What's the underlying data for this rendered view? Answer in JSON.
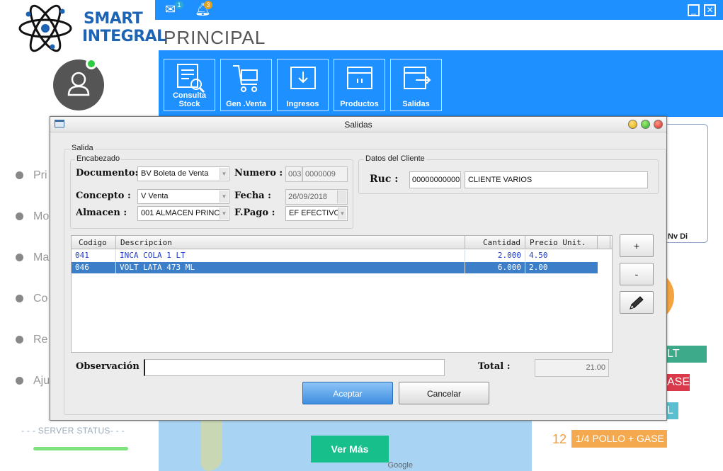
{
  "app": {
    "brand_line1": "SMART",
    "brand_line2": "INTEGRAL",
    "page_title": "PRINCIPAL",
    "mail_badge": "1",
    "bell_badge": "3",
    "ribbon": [
      {
        "label": "Consulta Stock",
        "icon": "stock-search-icon"
      },
      {
        "label": "Gen .Venta",
        "icon": "cart-icon"
      },
      {
        "label": "Ingresos",
        "icon": "inbox-download-icon"
      },
      {
        "label": "Productos",
        "icon": "box-icon"
      },
      {
        "label": "Salidas",
        "icon": "box-out-icon"
      }
    ],
    "menu": [
      "Pri",
      "Mo",
      "Ma",
      "Co",
      "Re",
      "Aju"
    ],
    "server_status": "- - - SERVER STATUS- - -",
    "ver_mas": "Ver Más",
    "map_credit": "Google",
    "right_panel_text": "Nv   Di",
    "chips": [
      "LT",
      "ASE",
      "L"
    ],
    "product_rank": "12",
    "product_name": "1/4 POLLO + GASE"
  },
  "dialog": {
    "title": "Salidas",
    "outer_group": "Salida",
    "header_group": "Encabezado",
    "client_group": "Datos del Cliente",
    "documento_label": "Documento:",
    "documento_value": "BV Boleta de Venta",
    "numero_label": "Numero :",
    "numero_serie": "003",
    "numero_correlativo": "0000009",
    "concepto_label": "Concepto :",
    "concepto_value": "V Venta",
    "fecha_label": "Fecha :",
    "fecha_value": "26/09/2018",
    "almacen_label": "Almacen :",
    "almacen_value": "001 ALMACEN PRINC",
    "fpago_label": "F.Pago :",
    "fpago_value": "EF EFECTIVO",
    "ruc_label": "Ruc :",
    "ruc_value": "00000000000",
    "cliente_value": "CLIENTE VARIOS",
    "columns": [
      "Codigo",
      "Descripcion",
      "Cantidad",
      "Precio Unit."
    ],
    "rows": [
      {
        "codigo": "041",
        "descripcion": "INCA COLA 1 LT",
        "cantidad": "2.000",
        "precio": "4.50"
      },
      {
        "codigo": "046",
        "descripcion": "VOLT LATA 473 ML",
        "cantidad": "6.000",
        "precio": "2.00"
      }
    ],
    "add_label": "+",
    "remove_label": "-",
    "observacion_label": "Observación",
    "observacion_value": "",
    "total_label": "Total :",
    "total_value": "21.00",
    "accept_label": "Aceptar",
    "cancel_label": "Cancelar"
  },
  "colors": {
    "brand_blue": "#1e90ff",
    "selected_row": "#3c7fc8",
    "row_text": "#1e3cc8"
  }
}
